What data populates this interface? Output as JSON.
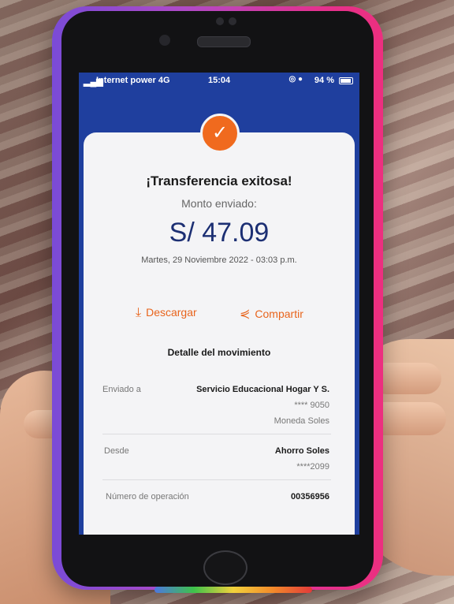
{
  "status_bar": {
    "carrier": "Internet power  4G",
    "time": "15:04",
    "battery": "94 %"
  },
  "receipt": {
    "title": "¡Transferencia exitosa!",
    "subtitle": "Monto enviado:",
    "amount": "S/ 47.09",
    "date": "Martes, 29 Noviembre 2022 - 03:03 p.m.",
    "download_label": "Descargar",
    "share_label": "Compartir",
    "section_title": "Detalle del movimiento",
    "sent_to_label": "Enviado a",
    "sent_to_name": "Servicio Educacional Hogar Y S.",
    "sent_to_account": "**** 9050",
    "sent_to_currency": "Moneda Soles",
    "from_label": "Desde",
    "from_account_name": "Ahorro Soles",
    "from_account_number": "****2099",
    "operation_label": "Número de operación",
    "operation_number": "00356956"
  },
  "colors": {
    "header_blue": "#1f3f9e",
    "accent_orange": "#f06a1e",
    "amount_navy": "#1c2f73"
  }
}
